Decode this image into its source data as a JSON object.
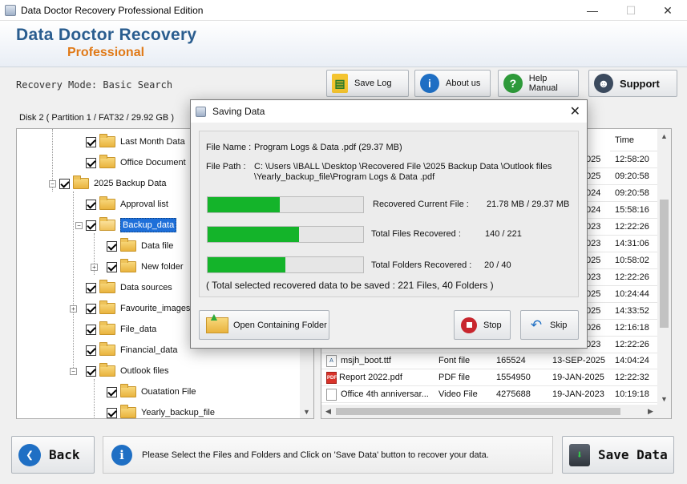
{
  "window": {
    "title": "Data Doctor Recovery Professional Edition",
    "minimize": "—",
    "maximize": "☐",
    "close": "✕"
  },
  "brand": {
    "line1": "Data Doctor Recovery",
    "line2": "Professional"
  },
  "mode_text": "Recovery Mode: Basic Search",
  "toolbar": {
    "save_log": "Save Log",
    "about_us": "About us",
    "help_manual": "Help Manual",
    "support": "Support"
  },
  "disk_label": "Disk 2 ( Partition 1 / FAT32 / 29.92 GB )",
  "tree": [
    {
      "label": "Last Month Data"
    },
    {
      "label": "Office Document"
    },
    {
      "label": "2025 Backup Data"
    },
    {
      "label": "Approval list"
    },
    {
      "label": "Backup_data"
    },
    {
      "label": "Data file"
    },
    {
      "label": "New folder"
    },
    {
      "label": "Data sources"
    },
    {
      "label": "Favourite_images"
    },
    {
      "label": "File_data"
    },
    {
      "label": "Financial_data"
    },
    {
      "label": "Outlook files"
    },
    {
      "label": "Ouatation File"
    },
    {
      "label": "Yearly_backup_file"
    }
  ],
  "list": {
    "time_header": "Time",
    "times": [
      "12:58:20",
      "09:20:58",
      "09:20:58",
      "15:58:16",
      "12:22:26",
      "14:31:06",
      "10:58:02",
      "12:22:26",
      "10:24:44",
      "14:33:52",
      "12:16:18",
      "12:22:26"
    ],
    "date_frags": [
      "025",
      "025",
      "024",
      "024",
      "023",
      "023",
      "025",
      "023",
      "025",
      "025",
      "026",
      "023"
    ],
    "rows": [
      {
        "name": "msjh_boot.ttf",
        "type": "Font file",
        "size": "165524",
        "date": "13-SEP-2025",
        "time": "14:04:24"
      },
      {
        "name": "Report 2022.pdf",
        "type": "PDF file",
        "size": "1554950",
        "date": "19-JAN-2025",
        "time": "12:22:32"
      },
      {
        "name": "Office 4th anniversar...",
        "type": "Video File",
        "size": "4275688",
        "date": "19-JAN-2023",
        "time": "10:19:18"
      }
    ]
  },
  "bottom": {
    "back": "Back",
    "info": "Please Select the Files and Folders and Click on 'Save Data' button to recover your data.",
    "save_data": "Save Data"
  },
  "dialog": {
    "title": "Saving Data",
    "close": "✕",
    "file_name_label": "File Name :",
    "file_name_value": "Program Logs & Data .pdf (29.37 MB)",
    "file_path_label": "File Path :",
    "file_path_line1": "C: \\Users \\IBALL \\Desktop \\Recovered File \\2025 Backup Data \\Outlook files",
    "file_path_line2": "\\Yearly_backup_file\\Program Logs & Data .pdf",
    "progress": [
      {
        "label": "Recovered Current File :",
        "value": "21.78 MB  /  29.37 MB",
        "fraction": 0.465
      },
      {
        "label": "Total Files Recovered :",
        "value": "140 / 221",
        "fraction": 0.59
      },
      {
        "label": "Total Folders Recovered :",
        "value": "20 / 40",
        "fraction": 0.5
      }
    ],
    "summary": "( Total selected recovered data to be saved : 221 Files, 40 Folders )",
    "open_folder": "Open Containing Folder",
    "stop": "Stop",
    "skip": "Skip"
  },
  "colors": {
    "brand_blue": "#2a5d8f",
    "brand_orange": "#e07a18",
    "progress_green": "#14b42a",
    "selection_blue": "#1e6fd9"
  }
}
